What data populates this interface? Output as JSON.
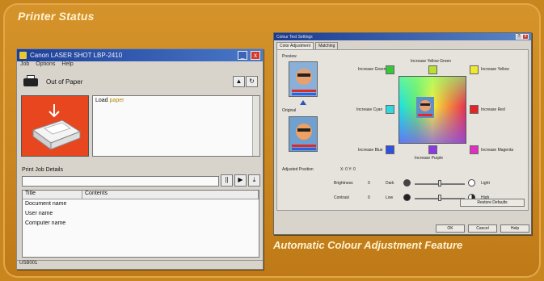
{
  "captions": {
    "printer_status": "Printer Status",
    "colour_feature": "Automatic Colour Adjustment Feature"
  },
  "printer_window": {
    "title": "Canon LASER SHOT LBP-2410",
    "minimize": "_",
    "close": "x",
    "menu": [
      "Job",
      "Options",
      "Help"
    ],
    "status": "Out of Paper",
    "message_prefix": "Load",
    "message_highlight": "paper",
    "print_job_details": "Print Job Details",
    "job_table": {
      "columns": [
        "Title",
        "Contents"
      ],
      "rows": [
        "Document name",
        "User name",
        "Computer name"
      ]
    },
    "statusbar": "USB001",
    "controls": [
      "||",
      "▶",
      "⤓"
    ]
  },
  "colour_window": {
    "title": "Colour Test Settings",
    "tabs": [
      "Color Adjustment",
      "Matching"
    ],
    "preview_label": "Preview",
    "original_label": "Original",
    "labels": {
      "increase_yellow_green": "Increase Yellow Green",
      "increase_green": "Increase Green",
      "increase_yellow": "Increase Yellow",
      "increase_cyan": "Increase Cyan",
      "increase_red": "Increase Red",
      "increase_blue": "Increase Blue",
      "increase_purple": "Increase Purple",
      "increase_magenta": "Increase Magenta",
      "adjusted_position": "Adjusted Position",
      "position_value": "X: 0   Y: 0",
      "brightness": "Brightness",
      "brightness_value": "0",
      "dark": "Dark",
      "light": "Light",
      "contrast": "Contrast",
      "contrast_value": "0",
      "low": "Low",
      "high": "High"
    },
    "buttons": {
      "restore_defaults": "Restore Defaults",
      "ok": "OK",
      "cancel": "Cancel",
      "help": "Help"
    }
  }
}
